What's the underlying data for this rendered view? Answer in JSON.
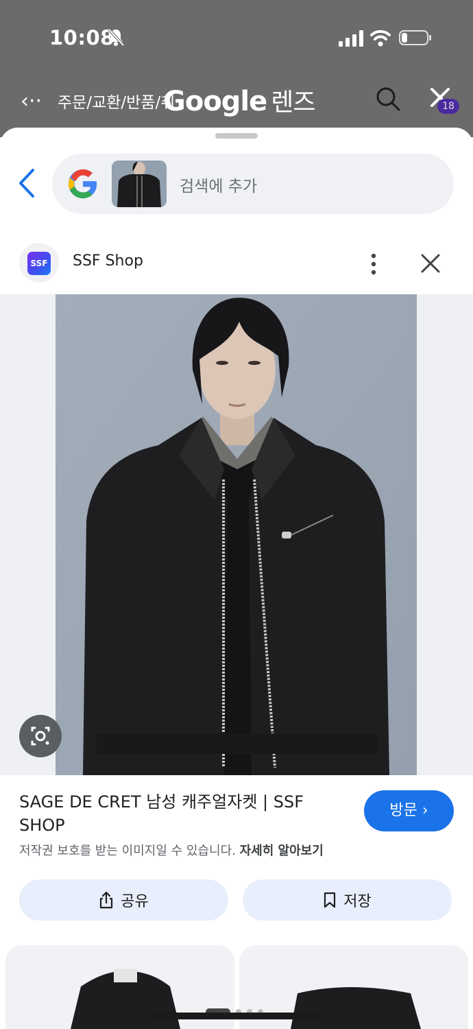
{
  "status_bar": {
    "time": "10:08"
  },
  "background_page": {
    "title": "주문/교환/반품/취",
    "lens_title": "Google",
    "lens_suffix": "렌즈",
    "badge_count": "18"
  },
  "search": {
    "placeholder": "검색에 추가"
  },
  "source": {
    "icon_text": "SSF",
    "name": "SSF Shop"
  },
  "result": {
    "title": "SAGE DE CRET 남성 캐주얼자켓 | SSF SHOP",
    "copyright_text": "저작권 보호를 받는 이미지일 수 있습니다.",
    "learn_more": "자세히 알아보기",
    "visit_label": "방문",
    "share_label": "공유",
    "save_label": "저장"
  },
  "colors": {
    "accent": "#1a73e8",
    "button_bg": "#e8eefb"
  }
}
